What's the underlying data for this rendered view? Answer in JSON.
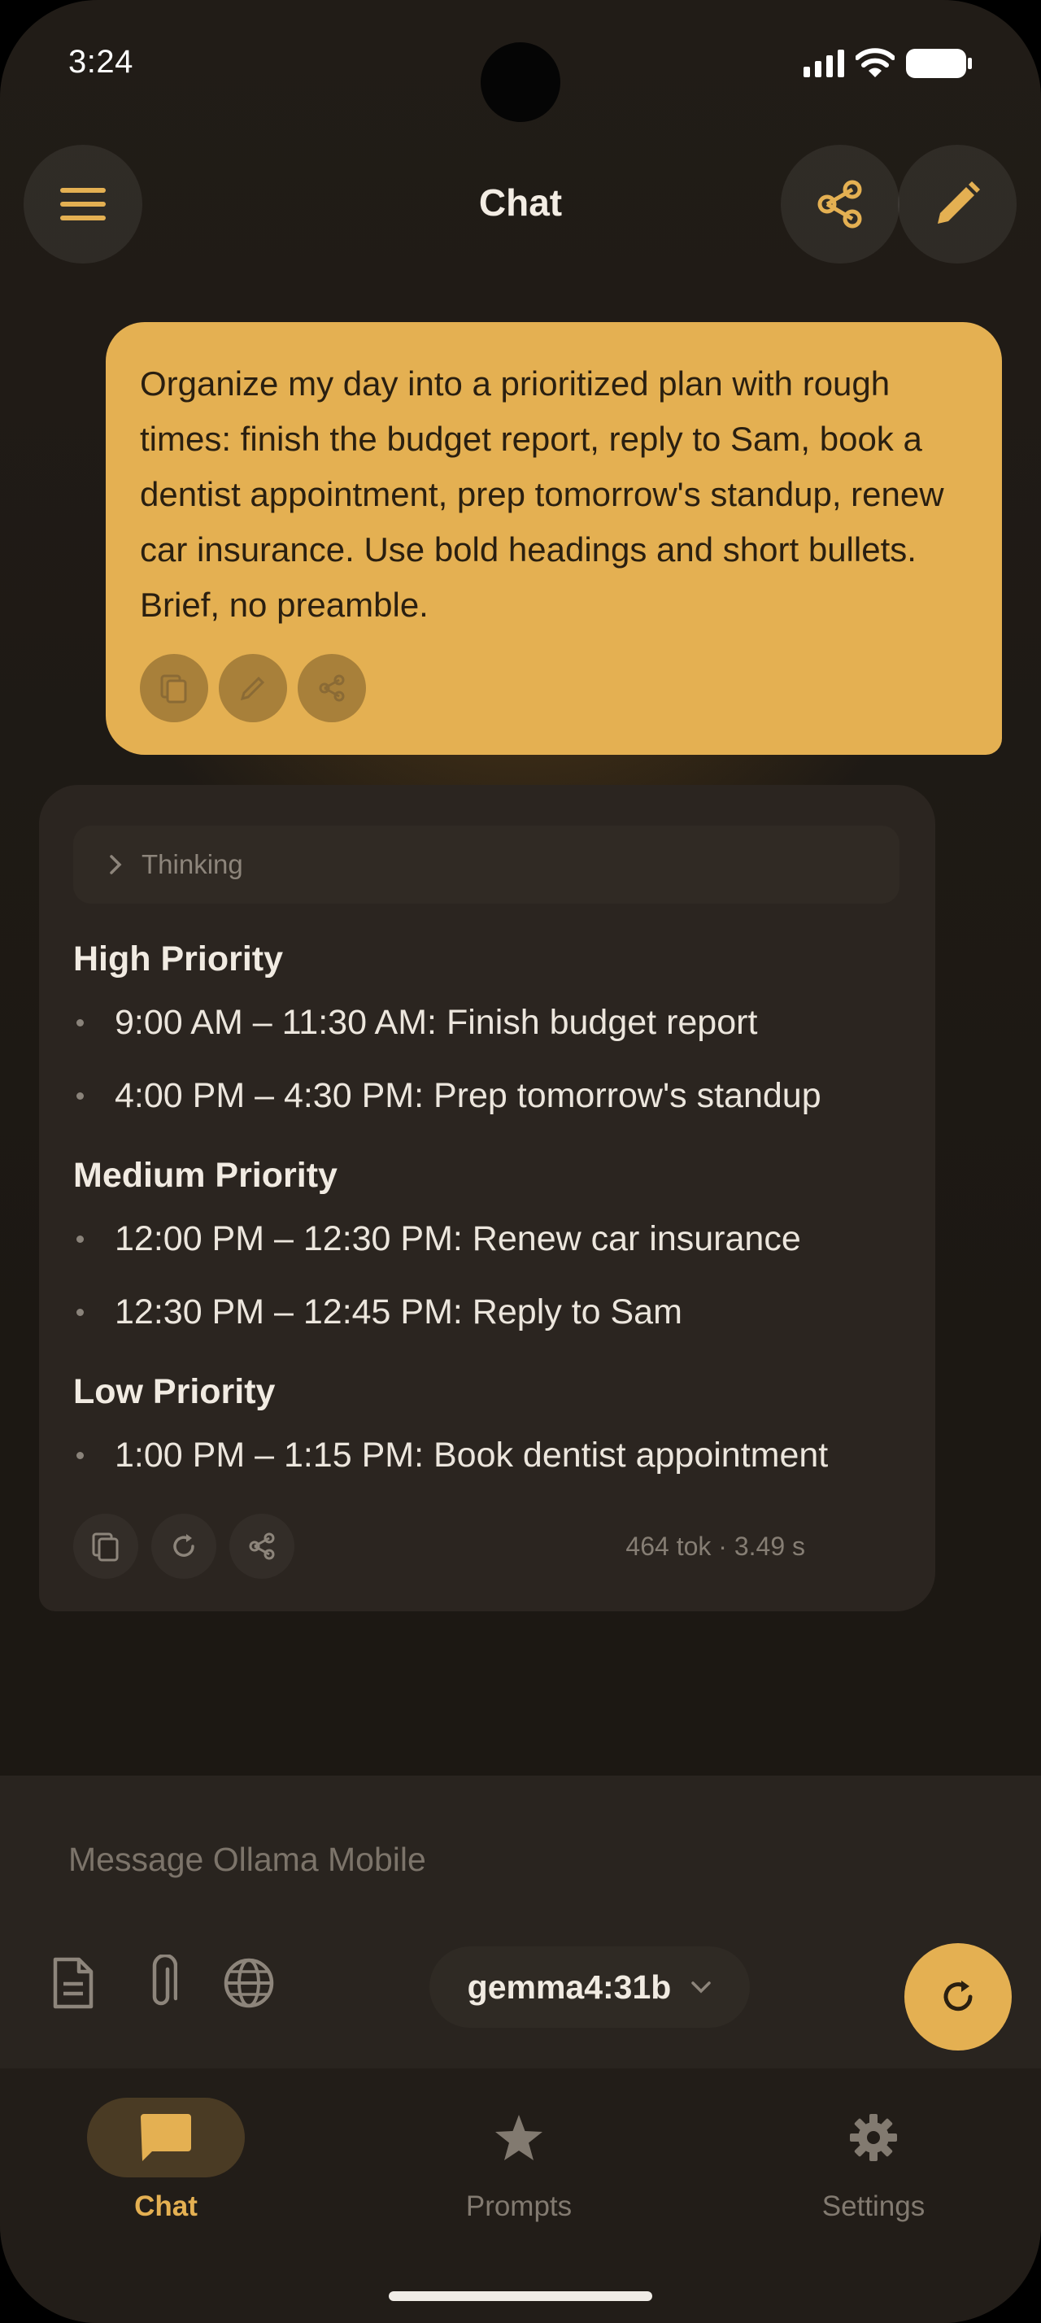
{
  "status_bar": {
    "time": "3:24"
  },
  "header": {
    "title": "Chat"
  },
  "user_message": {
    "text": "Organize my day into a prioritized plan with rough times: finish the budget report, reply to Sam, book a dentist appointment, prep tomorrow's standup, renew car insurance. Use bold headings and short bullets. Brief, no preamble."
  },
  "assistant_message": {
    "thinking_label": "Thinking",
    "sections": [
      {
        "heading": "High Priority",
        "items": [
          "9:00 AM – 11:30 AM: Finish budget report",
          "4:00 PM – 4:30 PM: Prep tomorrow's standup"
        ]
      },
      {
        "heading": "Medium Priority",
        "items": [
          "12:00 PM – 12:30 PM: Renew car insurance",
          "12:30 PM – 12:45 PM: Reply to Sam"
        ]
      },
      {
        "heading": "Low Priority",
        "items": [
          "1:00 PM – 1:15 PM: Book dentist appointment"
        ]
      }
    ],
    "stats": "464 tok · 3.49 s"
  },
  "composer": {
    "placeholder": "Message Ollama Mobile",
    "model": "gemma4:31b"
  },
  "nav": {
    "items": [
      {
        "label": "Chat",
        "icon": "chat-bubble-icon",
        "active": true
      },
      {
        "label": "Prompts",
        "icon": "star-icon",
        "active": false
      },
      {
        "label": "Settings",
        "icon": "gear-icon",
        "active": false
      }
    ]
  },
  "colors": {
    "accent": "#e4b052",
    "background": "#1c1813",
    "card": "#2b2520",
    "nav_background": "#221d18"
  }
}
